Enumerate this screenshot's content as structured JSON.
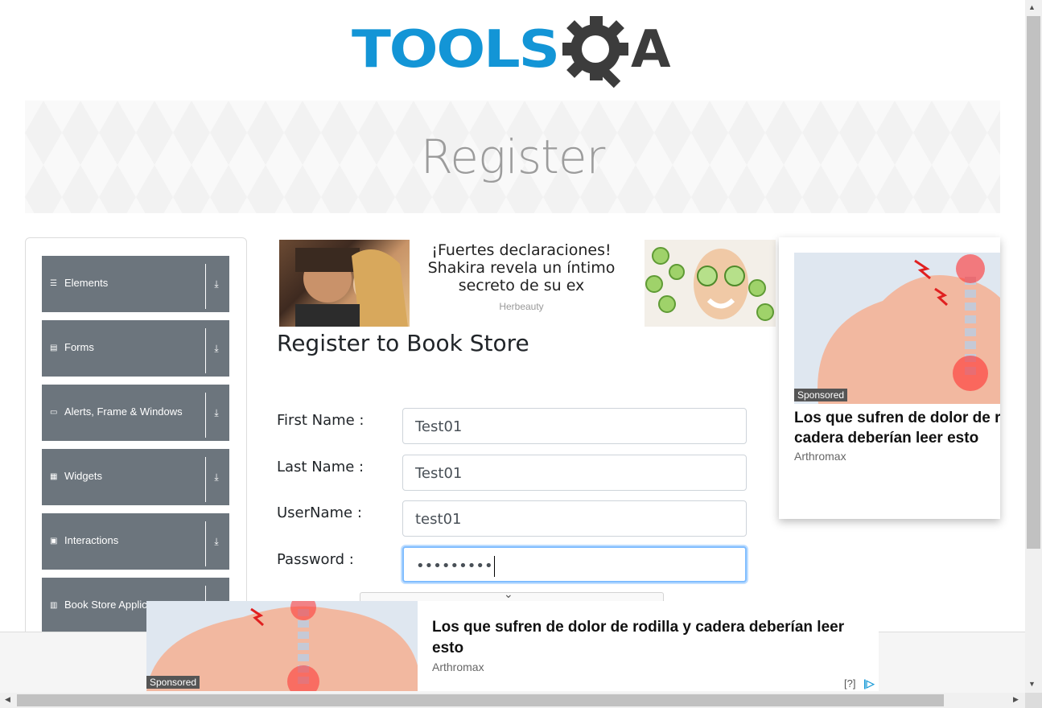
{
  "logo": {
    "part1": "TOOLS",
    "part2": "A"
  },
  "banner": {
    "title": "Register"
  },
  "sidebar": {
    "groups": [
      {
        "label": "Elements",
        "icon": "list-icon"
      },
      {
        "label": "Forms",
        "icon": "doc-icon"
      },
      {
        "label": "Alerts, Frame & Windows",
        "icon": "window-icon"
      },
      {
        "label": "Widgets",
        "icon": "grid-icon"
      },
      {
        "label": "Interactions",
        "icon": "cursor-icon"
      },
      {
        "label": "Book Store Applica",
        "icon": "books-icon"
      }
    ]
  },
  "ad_top": {
    "headline": "¡Fuertes declaraciones! Shakira revela un íntimo secreto de su ex",
    "source": "Herbeauty"
  },
  "ad_right": {
    "sponsored": "Sponsored",
    "headline": "Los que sufren de dolor de rodilla y cadera deberían leer esto",
    "headline_line1": "Los que sufren de dolor de roc",
    "headline_line2": "cadera deberían leer esto",
    "source": "Arthromax"
  },
  "form": {
    "title": "Register to Book Store",
    "first_name_label": "First Name :",
    "first_name_value": "Test01",
    "last_name_label": "Last Name :",
    "last_name_value": "Test01",
    "username_label": "UserName :",
    "username_value": "test01",
    "password_label": "Password :",
    "password_value": "•••••••••"
  },
  "ad_bottom": {
    "sponsored": "Sponsored",
    "headline": "Los que sufren de dolor de rodilla y cadera deberían leer esto",
    "source": "Arthromax",
    "help": "[?]"
  },
  "colors": {
    "logo_blue": "#1395d6",
    "sidebar_group": "#6c757d",
    "focus_border": "#80bdff"
  }
}
